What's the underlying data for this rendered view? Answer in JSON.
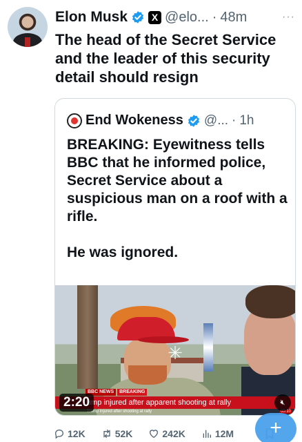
{
  "tweet": {
    "author_name": "Elon Musk",
    "handle": "@elo...",
    "separator": "·",
    "time": "48m",
    "more_glyph": "···",
    "x_badge": "X",
    "text": "The head of the Secret Service and the leader of this security detail should resign"
  },
  "quote": {
    "author_name": "End Wokeness",
    "handle": "@...",
    "separator": "·",
    "time": "1h",
    "text": "BREAKING: Eyewitness tells BBC that he informed police, Secret Service about a suspicious man on a roof with a rifle.\n\nHe was ignored."
  },
  "video": {
    "duration": "2:20",
    "channel_tag": "BBC NEWS",
    "breaking_tag": "BREAKING",
    "headline": "ump injured after apparent shooting at rally",
    "subheadline": "Trump injured after shooting at rally",
    "clock": "00:10",
    "mute_icon": "speaker-muted-icon"
  },
  "actions": {
    "replies": "12K",
    "reposts": "52K",
    "likes": "242K",
    "views": "12M"
  },
  "fab": {
    "label": "+"
  },
  "colors": {
    "text": "#0f1419",
    "secondary": "#536471",
    "verified": "#1d9bf0",
    "border": "#cfd9de",
    "fab": "#4aa1eb",
    "news_red": "#c8101c"
  }
}
